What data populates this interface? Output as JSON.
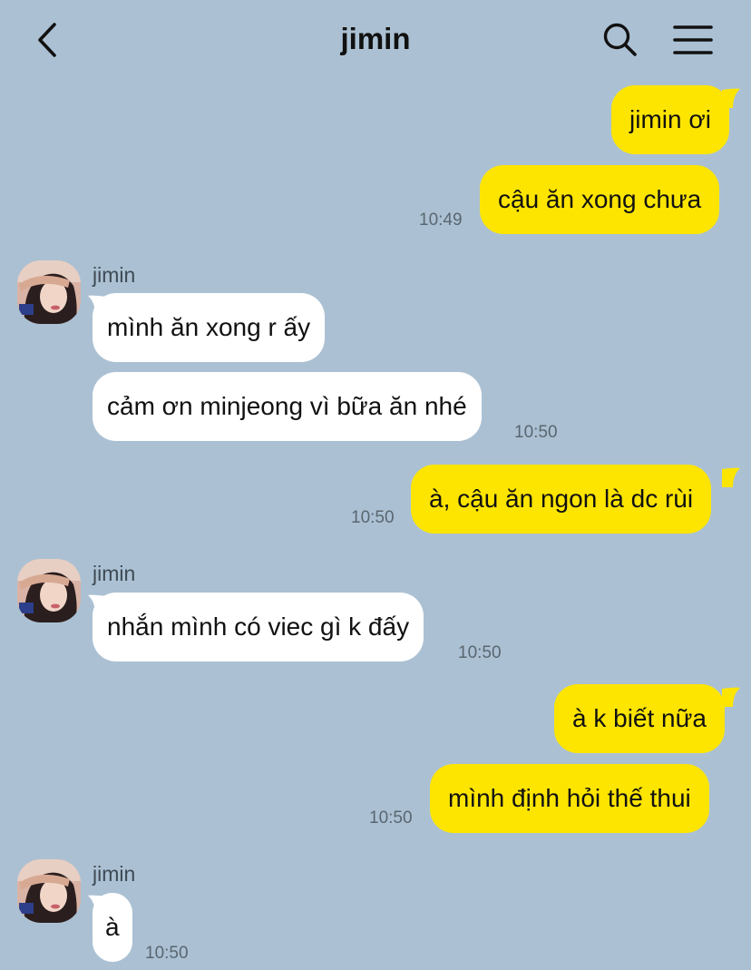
{
  "header": {
    "title": "jimin",
    "back_icon": "chevron-left-icon",
    "search_icon": "search-icon",
    "menu_icon": "hamburger-menu-icon"
  },
  "colors": {
    "background": "#abc1d3",
    "my_bubble": "#fee500",
    "their_bubble": "#ffffff"
  },
  "messages": [
    {
      "from": "me",
      "text": "jimin ơi"
    },
    {
      "from": "me",
      "text": "cậu ăn xong chưa",
      "time": "10:49"
    },
    {
      "from": "jimin",
      "sender": "jimin",
      "text": "mình ăn xong r ấy"
    },
    {
      "from": "jimin",
      "text": "cảm ơn minjeong vì bữa ăn nhé",
      "time": "10:50"
    },
    {
      "from": "me",
      "text": "à, cậu ăn ngon là dc rùi",
      "time": "10:50"
    },
    {
      "from": "jimin",
      "sender": "jimin",
      "text": "nhắn mình có viec gì k đấy",
      "time": "10:50"
    },
    {
      "from": "me",
      "text": "à k biết nữa"
    },
    {
      "from": "me",
      "text": "mình định hỏi thế thui",
      "time": "10:50"
    },
    {
      "from": "jimin",
      "sender": "jimin",
      "text": "à",
      "time": "10:50"
    }
  ]
}
